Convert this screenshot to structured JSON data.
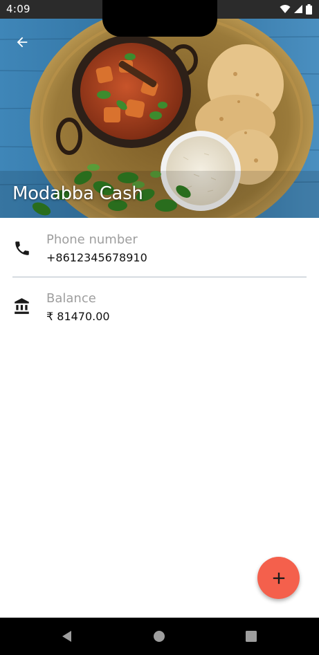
{
  "status_bar": {
    "time": "4:09",
    "icons": [
      "wifi-icon",
      "signal-icon",
      "battery-icon"
    ]
  },
  "header": {
    "title": "Modabba Cash",
    "back_icon": "arrow-left-icon"
  },
  "details": {
    "phone": {
      "icon": "phone-icon",
      "label": "Phone number",
      "value": "+8612345678910"
    },
    "balance": {
      "icon": "bank-icon",
      "label": "Balance",
      "value": "₹ 81470.00"
    }
  },
  "fab": {
    "icon": "plus-icon",
    "color": "#f4604c"
  },
  "nav_bar": {
    "icons": [
      "back-triangle-icon",
      "home-circle-icon",
      "recents-square-icon"
    ]
  }
}
